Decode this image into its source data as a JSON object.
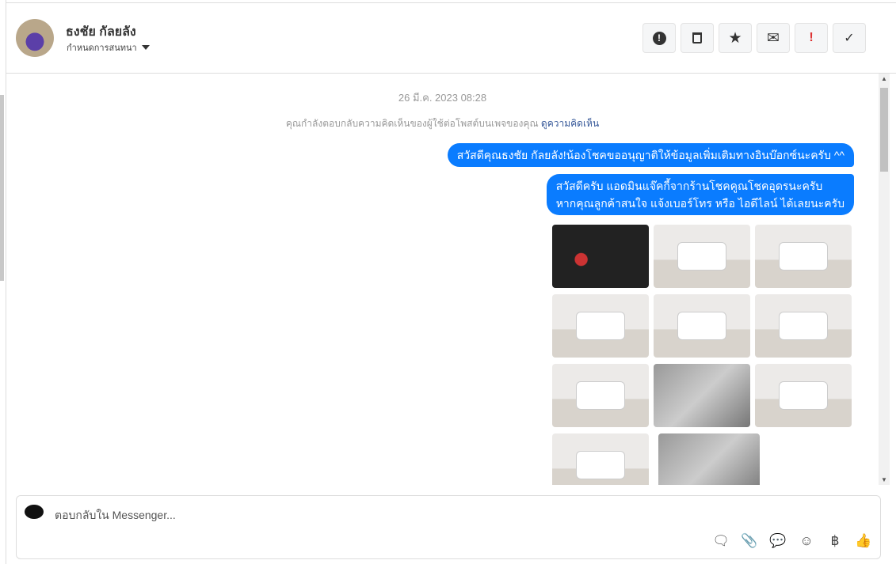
{
  "header": {
    "name": "ธงชัย กัลยลัง",
    "assign_label": "กำหนดการสนทนา"
  },
  "actions": [
    {
      "name": "report-icon",
      "glyph": "●!"
    },
    {
      "name": "trash-icon",
      "glyph": "🗑"
    },
    {
      "name": "star-icon",
      "glyph": "★"
    },
    {
      "name": "envelope-icon",
      "glyph": "✉"
    },
    {
      "name": "exclamation-icon",
      "glyph": "!"
    },
    {
      "name": "check-icon",
      "glyph": "✓"
    }
  ],
  "chat": {
    "timestamp": "26 มี.ค. 2023 08:28",
    "notice": "คุณกำลังตอบกลับความคิดเห็นของผู้ใช้ต่อโพสต์บนเพจของคุณ",
    "notice_link": "ดูความคิดเห็น",
    "messages": [
      "สวัสดีคุณธงชัย กัลยลัง!น้องโชคขออนุญาติให้ข้อมูลเพิ่มเติมทางอินบ๊อกซ์นะครับ ^^",
      "สวัสดีครับ แอดมินแจ๊คกี้จากร้านโชคคูณโชคอุดรนะครับ",
      "หากคุณลูกค้าสนใจ แจ้งเบอร์โทร หรือ ไอดีไลน์ ได้เลยนะครับ"
    ],
    "photo_count": 11
  },
  "composer": {
    "placeholder": "ตอบกลับใน Messenger...",
    "baht": "฿"
  }
}
